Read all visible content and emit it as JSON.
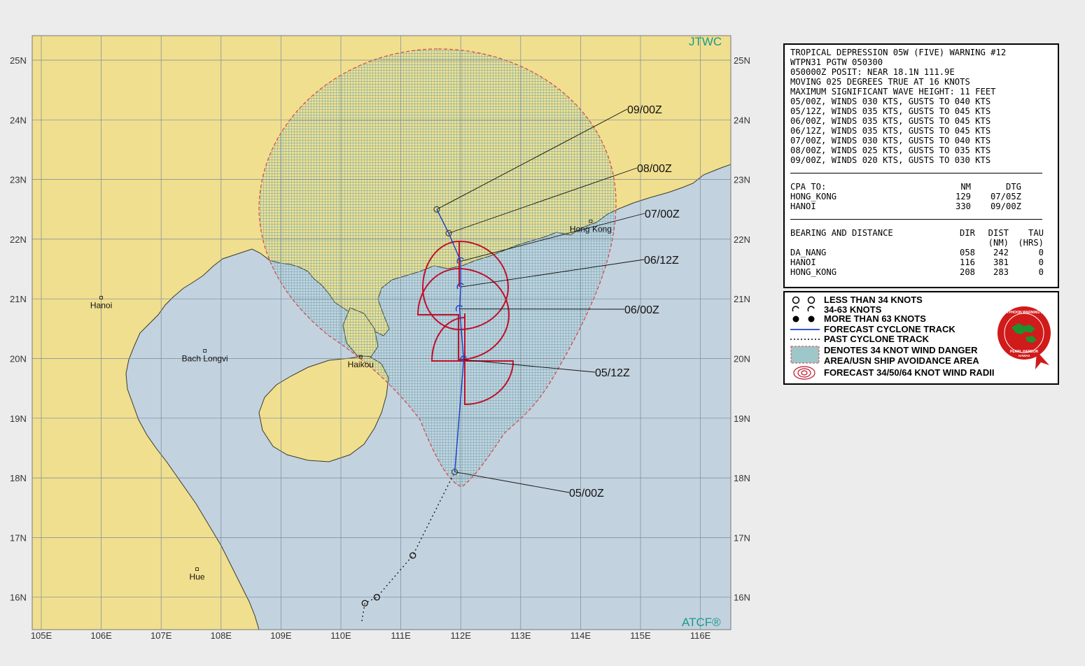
{
  "corner_labels": {
    "top_right": "JTWC",
    "bottom_right": "ATCF®"
  },
  "lat_labels": [
    "25N",
    "24N",
    "23N",
    "22N",
    "21N",
    "20N",
    "19N",
    "18N",
    "17N",
    "16N"
  ],
  "lon_labels": [
    "105E",
    "106E",
    "107E",
    "108E",
    "109E",
    "110E",
    "111E",
    "112E",
    "113E",
    "114E",
    "115E",
    "116E"
  ],
  "cities": [
    {
      "name": "Hanoi",
      "lon": 106.0,
      "lat": 21.02
    },
    {
      "name": "Bach Longvi",
      "lon": 107.73,
      "lat": 20.13
    },
    {
      "name": "Haikou",
      "lon": 110.33,
      "lat": 20.03
    },
    {
      "name": "Hue",
      "lon": 107.6,
      "lat": 16.47
    },
    {
      "name": "Hong Kong",
      "lon": 114.17,
      "lat": 22.3
    }
  ],
  "forecast_track": [
    {
      "dtg": "05/00Z",
      "lon": 111.9,
      "lat": 18.1
    },
    {
      "dtg": "05/12Z",
      "lon": 112.05,
      "lat": 19.98
    },
    {
      "dtg": "06/00Z",
      "lon": 111.98,
      "lat": 20.83
    },
    {
      "dtg": "06/12Z",
      "lon": 112.0,
      "lat": 21.2
    },
    {
      "dtg": "07/00Z",
      "lon": 112.0,
      "lat": 21.63
    },
    {
      "dtg": "08/00Z",
      "lon": 111.8,
      "lat": 22.1
    },
    {
      "dtg": "09/00Z",
      "lon": 111.6,
      "lat": 22.5
    }
  ],
  "past_track": [
    {
      "lon": 110.35,
      "lat": 15.6
    },
    {
      "lon": 110.4,
      "lat": 15.9
    },
    {
      "lon": 110.6,
      "lat": 16.0
    },
    {
      "lon": 111.2,
      "lat": 16.7
    },
    {
      "lon": 111.9,
      "lat": 18.1
    }
  ],
  "warning": {
    "lines": [
      "TROPICAL DEPRESSION 05W (FIVE) WARNING #12",
      "WTPN31 PGTW 050300",
      "050000Z POSIT: NEAR 18.1N 111.9E",
      "MOVING 025 DEGREES TRUE AT 16 KNOTS",
      "MAXIMUM SIGNIFICANT WAVE HEIGHT: 11 FEET",
      "05/00Z, WINDS 030 KTS, GUSTS TO 040 KTS",
      "05/12Z, WINDS 035 KTS, GUSTS TO 045 KTS",
      "06/00Z, WINDS 035 KTS, GUSTS TO 045 KTS",
      "06/12Z, WINDS 035 KTS, GUSTS TO 045 KTS",
      "07/00Z, WINDS 030 KTS, GUSTS TO 040 KTS",
      "08/00Z, WINDS 025 KTS, GUSTS TO 035 KTS",
      "09/00Z, WINDS 020 KTS, GUSTS TO 030 KTS"
    ],
    "cpa": {
      "header": [
        "CPA TO:",
        "NM",
        "DTG"
      ],
      "rows": [
        [
          "HONG_KONG",
          "129",
          "07/05Z"
        ],
        [
          "HANOI",
          "330",
          "09/00Z"
        ]
      ]
    },
    "bearing": {
      "header": [
        "BEARING AND DISTANCE",
        "DIR",
        "DIST",
        "TAU"
      ],
      "subheader": [
        "",
        "",
        "(NM)",
        "(HRS)"
      ],
      "rows": [
        [
          "DA_NANG",
          "058",
          "242",
          "0"
        ],
        [
          "HANOI",
          "116",
          "381",
          "0"
        ],
        [
          "HONG_KONG",
          "208",
          "283",
          "0"
        ]
      ]
    }
  },
  "legend": [
    {
      "icon": "less-than-34kt-icon",
      "text": "LESS THAN 34 KNOTS"
    },
    {
      "icon": "34-63kt-icon",
      "text": "34-63 KNOTS"
    },
    {
      "icon": "more-than-63kt-icon",
      "text": "MORE THAN 63 KNOTS"
    },
    {
      "icon": "forecast-track-icon",
      "text": "FORECAST CYCLONE TRACK"
    },
    {
      "icon": "past-track-icon",
      "text": "PAST CYCLONE TRACK"
    },
    {
      "icon": "danger-area-icon",
      "text": "DENOTES 34 KNOT WIND DANGER"
    },
    {
      "icon": "",
      "text": "AREA/USN SHIP AVOIDANCE AREA"
    },
    {
      "icon": "wind-radii-icon",
      "text": "FORECAST 34/50/64 KNOT WIND RADII"
    }
  ],
  "seal_text": [
    "JOINT TYPHOON WARNING CENTER",
    "PEARL HARBOR",
    "HAWAII"
  ],
  "colors": {
    "land": "#f0df8f",
    "sea": "#c3d2df",
    "grid": "#7a8a99",
    "track": "#1a3ccc",
    "radii": "#c0102a",
    "danger": "#9ec7c9",
    "danger_edge": "#d94444",
    "coast": "#3a3a2a",
    "accent": "#1a9a8a"
  }
}
